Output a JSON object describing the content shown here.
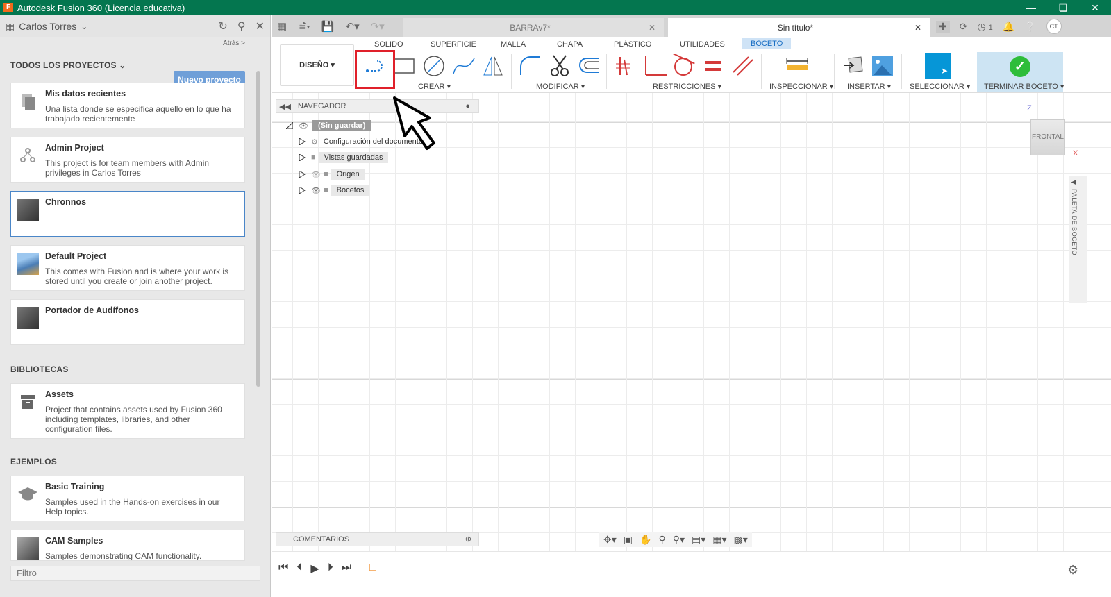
{
  "window": {
    "title": "Autodesk Fusion 360 (Licencia educativa)",
    "app_icon": "F"
  },
  "left_panel": {
    "user": "Carlos Torres",
    "back_label": "Atrás >",
    "all_projects": "TODOS LOS PROYECTOS",
    "new_project": "Nuevo proyecto",
    "projects": [
      {
        "name": "Mis datos recientes",
        "desc": "Una lista donde se especifica aquello en lo que ha trabajado recientemente",
        "icon": "documents-icon"
      },
      {
        "name": "Admin Project",
        "desc": "This project is for team members with Admin privileges in Carlos Torres",
        "icon": "network-icon"
      },
      {
        "name": "Chronnos",
        "desc": "",
        "icon": "project-thumbnail-icon",
        "selected": true
      },
      {
        "name": "Default Project",
        "desc": "This comes with Fusion and is where your work is stored until you create or join another project.",
        "icon": "solar-thumbnail-icon"
      },
      {
        "name": "Portador de Audífonos",
        "desc": "",
        "icon": "project-thumbnail-icon"
      }
    ],
    "libraries_label": "BIBLIOTECAS",
    "libraries": [
      {
        "name": "Assets",
        "desc": "Project that contains assets used by Fusion 360 including templates, libraries, and other configuration files.",
        "icon": "archive-icon"
      }
    ],
    "examples_label": "EJEMPLOS",
    "examples": [
      {
        "name": "Basic Training",
        "desc": "Samples used in the Hands-on exercises in our Help topics.",
        "icon": "graduation-cap-icon"
      },
      {
        "name": "CAM Samples",
        "desc": "Samples demonstrating CAM functionality.",
        "icon": "cam-thumbnail-icon"
      }
    ],
    "filter_placeholder": "Filtro"
  },
  "tabs": {
    "inactive": "BARRAv7*",
    "active": "Sin título*",
    "job_count": "1",
    "user_initials": "CT"
  },
  "ribbon": {
    "workspace": "DISEÑO",
    "tabs": [
      "SOLIDO",
      "SUPERFICIE",
      "MALLA",
      "CHAPA",
      "PLÁSTICO",
      "UTILIDADES",
      "BOCETO"
    ],
    "active_tab": "BOCETO",
    "groups": {
      "create": "CREAR",
      "modify": "MODIFICAR",
      "constraints": "RESTRICCIONES",
      "inspect": "INSPECCIONAR",
      "insert": "INSERTAR",
      "select": "SELECCIONAR",
      "finish": "TERMINAR BOCETO"
    }
  },
  "browser": {
    "title": "NAVEGADOR",
    "root": "(Sin guardar)",
    "items": [
      "Configuración del documento",
      "Vistas guardadas",
      "Origen",
      "Bocetos"
    ]
  },
  "comments": "COMENTARIOS",
  "viewcube": {
    "face": "FRONTAL",
    "axis_z": "Z",
    "axis_x": "X"
  },
  "palette": "PALETA DE BOCETO",
  "colors": {
    "titlebar": "#04764f",
    "accent": "#0696d7",
    "highlight": "#e0202a",
    "finish_check": "#2ebd3a"
  }
}
